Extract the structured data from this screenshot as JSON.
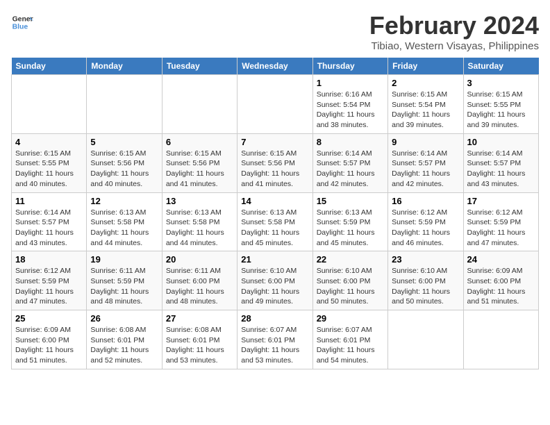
{
  "logo": {
    "text_general": "General",
    "text_blue": "Blue"
  },
  "header": {
    "title": "February 2024",
    "subtitle": "Tibiao, Western Visayas, Philippines"
  },
  "days_of_week": [
    "Sunday",
    "Monday",
    "Tuesday",
    "Wednesday",
    "Thursday",
    "Friday",
    "Saturday"
  ],
  "weeks": [
    [
      {
        "day": "",
        "info": ""
      },
      {
        "day": "",
        "info": ""
      },
      {
        "day": "",
        "info": ""
      },
      {
        "day": "",
        "info": ""
      },
      {
        "day": "1",
        "info": "Sunrise: 6:16 AM\nSunset: 5:54 PM\nDaylight: 11 hours and 38 minutes."
      },
      {
        "day": "2",
        "info": "Sunrise: 6:15 AM\nSunset: 5:54 PM\nDaylight: 11 hours and 39 minutes."
      },
      {
        "day": "3",
        "info": "Sunrise: 6:15 AM\nSunset: 5:55 PM\nDaylight: 11 hours and 39 minutes."
      }
    ],
    [
      {
        "day": "4",
        "info": "Sunrise: 6:15 AM\nSunset: 5:55 PM\nDaylight: 11 hours and 40 minutes."
      },
      {
        "day": "5",
        "info": "Sunrise: 6:15 AM\nSunset: 5:56 PM\nDaylight: 11 hours and 40 minutes."
      },
      {
        "day": "6",
        "info": "Sunrise: 6:15 AM\nSunset: 5:56 PM\nDaylight: 11 hours and 41 minutes."
      },
      {
        "day": "7",
        "info": "Sunrise: 6:15 AM\nSunset: 5:56 PM\nDaylight: 11 hours and 41 minutes."
      },
      {
        "day": "8",
        "info": "Sunrise: 6:14 AM\nSunset: 5:57 PM\nDaylight: 11 hours and 42 minutes."
      },
      {
        "day": "9",
        "info": "Sunrise: 6:14 AM\nSunset: 5:57 PM\nDaylight: 11 hours and 42 minutes."
      },
      {
        "day": "10",
        "info": "Sunrise: 6:14 AM\nSunset: 5:57 PM\nDaylight: 11 hours and 43 minutes."
      }
    ],
    [
      {
        "day": "11",
        "info": "Sunrise: 6:14 AM\nSunset: 5:57 PM\nDaylight: 11 hours and 43 minutes."
      },
      {
        "day": "12",
        "info": "Sunrise: 6:13 AM\nSunset: 5:58 PM\nDaylight: 11 hours and 44 minutes."
      },
      {
        "day": "13",
        "info": "Sunrise: 6:13 AM\nSunset: 5:58 PM\nDaylight: 11 hours and 44 minutes."
      },
      {
        "day": "14",
        "info": "Sunrise: 6:13 AM\nSunset: 5:58 PM\nDaylight: 11 hours and 45 minutes."
      },
      {
        "day": "15",
        "info": "Sunrise: 6:13 AM\nSunset: 5:59 PM\nDaylight: 11 hours and 45 minutes."
      },
      {
        "day": "16",
        "info": "Sunrise: 6:12 AM\nSunset: 5:59 PM\nDaylight: 11 hours and 46 minutes."
      },
      {
        "day": "17",
        "info": "Sunrise: 6:12 AM\nSunset: 5:59 PM\nDaylight: 11 hours and 47 minutes."
      }
    ],
    [
      {
        "day": "18",
        "info": "Sunrise: 6:12 AM\nSunset: 5:59 PM\nDaylight: 11 hours and 47 minutes."
      },
      {
        "day": "19",
        "info": "Sunrise: 6:11 AM\nSunset: 5:59 PM\nDaylight: 11 hours and 48 minutes."
      },
      {
        "day": "20",
        "info": "Sunrise: 6:11 AM\nSunset: 6:00 PM\nDaylight: 11 hours and 48 minutes."
      },
      {
        "day": "21",
        "info": "Sunrise: 6:10 AM\nSunset: 6:00 PM\nDaylight: 11 hours and 49 minutes."
      },
      {
        "day": "22",
        "info": "Sunrise: 6:10 AM\nSunset: 6:00 PM\nDaylight: 11 hours and 50 minutes."
      },
      {
        "day": "23",
        "info": "Sunrise: 6:10 AM\nSunset: 6:00 PM\nDaylight: 11 hours and 50 minutes."
      },
      {
        "day": "24",
        "info": "Sunrise: 6:09 AM\nSunset: 6:00 PM\nDaylight: 11 hours and 51 minutes."
      }
    ],
    [
      {
        "day": "25",
        "info": "Sunrise: 6:09 AM\nSunset: 6:00 PM\nDaylight: 11 hours and 51 minutes."
      },
      {
        "day": "26",
        "info": "Sunrise: 6:08 AM\nSunset: 6:01 PM\nDaylight: 11 hours and 52 minutes."
      },
      {
        "day": "27",
        "info": "Sunrise: 6:08 AM\nSunset: 6:01 PM\nDaylight: 11 hours and 53 minutes."
      },
      {
        "day": "28",
        "info": "Sunrise: 6:07 AM\nSunset: 6:01 PM\nDaylight: 11 hours and 53 minutes."
      },
      {
        "day": "29",
        "info": "Sunrise: 6:07 AM\nSunset: 6:01 PM\nDaylight: 11 hours and 54 minutes."
      },
      {
        "day": "",
        "info": ""
      },
      {
        "day": "",
        "info": ""
      }
    ]
  ]
}
